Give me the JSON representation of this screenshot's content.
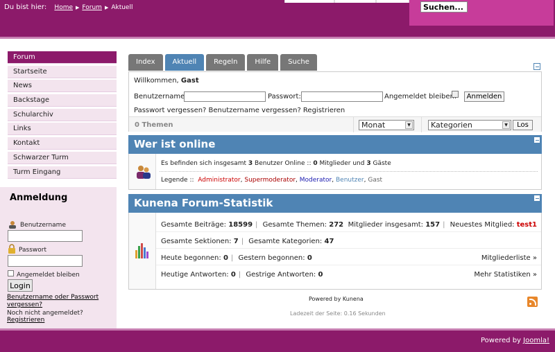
{
  "header": {
    "breadcrumb_prefix": "Du bist hier:",
    "breadcrumb": [
      "Home",
      "Forum",
      "Aktuell"
    ],
    "search_placeholder": "Suchen..."
  },
  "sidebar": {
    "menu": [
      {
        "label": "Forum",
        "active": true
      },
      {
        "label": "Startseite"
      },
      {
        "label": "News"
      },
      {
        "label": "Backstage"
      },
      {
        "label": "Schularchiv"
      },
      {
        "label": "Links"
      },
      {
        "label": "Kontakt"
      },
      {
        "label": "Schwarzer Turm"
      },
      {
        "label": "Turm Eingang"
      }
    ],
    "login": {
      "title": "Anmeldung",
      "username_label": "Benutzername",
      "password_label": "Passwort",
      "remember_label": "Angemeldet bleiben",
      "login_button": "Login",
      "forgot_link": "Benutzername oder Passwort vergessen?",
      "not_registered": "Noch nicht angemeldet?",
      "register_link": "Registrieren"
    }
  },
  "main": {
    "tabs": [
      {
        "label": "Index"
      },
      {
        "label": "Aktuell",
        "active": true
      },
      {
        "label": "Regeln"
      },
      {
        "label": "Hilfe"
      },
      {
        "label": "Suche"
      }
    ],
    "loginbox": {
      "welcome_prefix": "Willkommen,",
      "welcome_name": "Gast",
      "username_label": "Benutzername:",
      "password_label": "Passwort:",
      "remember_label": "Angemeldet bleiben:",
      "login_button": "Anmelden",
      "links": "Passwort vergessen? Benutzername vergessen? Registrieren",
      "themen_count": "0 Themen",
      "period_select": "Monat",
      "category_select": "Kategorien",
      "go_button": "Los"
    },
    "online": {
      "title": "Wer ist online",
      "text_prefix": "Es befinden sich insgesamt",
      "total": "3",
      "text_mid": "Benutzer Online  ::",
      "members": "0",
      "text_mid2": "Mitglieder und",
      "guests": "3",
      "text_end": "Gäste",
      "legend_label": "Legende ::",
      "legend": [
        "Administrator",
        "Supermoderator",
        "Moderator",
        "Benutzer",
        "Gast"
      ]
    },
    "stats": {
      "title": "Kunena Forum-Statistik",
      "posts_label": "Gesamte Beiträge:",
      "posts": "18599",
      "topics_label": "Gesamte Themen:",
      "topics": "272",
      "members_label": "Mitglieder insgesamt:",
      "members": "157",
      "newest_label": "Neuestes Mitglied:",
      "newest": "test1",
      "sections_label": "Gesamte Sektionen:",
      "sections": "7",
      "categories_label": "Gesamte Kategorien:",
      "categories": "47",
      "today_label": "Heute begonnen:",
      "today": "0",
      "yesterday_label": "Gestern begonnen:",
      "yesterday": "0",
      "memberlist_link": "Mitgliederliste »",
      "today_replies_label": "Heutige Antworten:",
      "today_replies": "0",
      "yesterday_replies_label": "Gestrige Antworten:",
      "yesterday_replies": "0",
      "more_stats_link": "Mehr Statistiken »"
    },
    "powered_kunena": "Powered by Kunena",
    "load_time": "Ladezeit der Seite: 0.16 Sekunden"
  },
  "footer": {
    "powered_prefix": "Powered by",
    "powered_link": "Joomla!"
  },
  "colors": {
    "brand": "#8c1a6a",
    "accent": "#4f84b4",
    "search_bg": "#c73c9a"
  }
}
